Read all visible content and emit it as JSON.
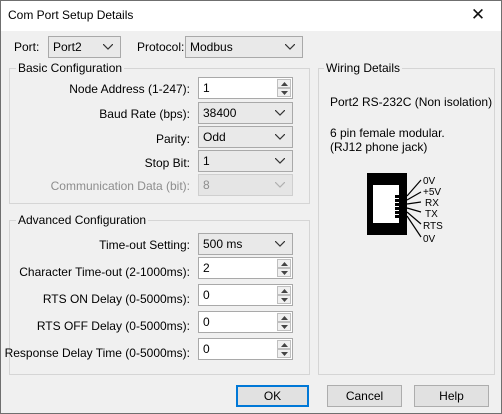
{
  "window": {
    "title": "Com Port Setup Details",
    "close_glyph": "✕"
  },
  "top": {
    "port_label": "Port:",
    "port_value": "Port2",
    "protocol_label": "Protocol:",
    "protocol_value": "Modbus"
  },
  "basic": {
    "title": "Basic Configuration",
    "node_address_label": "Node Address (1-247):",
    "node_address_value": "1",
    "baud_rate_label": "Baud Rate (bps):",
    "baud_rate_value": "38400",
    "parity_label": "Parity:",
    "parity_value": "Odd",
    "stop_bit_label": "Stop Bit:",
    "stop_bit_value": "1",
    "comm_data_label": "Communication Data (bit):",
    "comm_data_value": "8"
  },
  "advanced": {
    "title": "Advanced Configuration",
    "timeout_label": "Time-out Setting:",
    "timeout_value": "500 ms",
    "char_timeout_label": "Character Time-out (2-1000ms):",
    "char_timeout_value": "2",
    "rts_on_label": "RTS ON Delay (0-5000ms):",
    "rts_on_value": "0",
    "rts_off_label": "RTS OFF Delay (0-5000ms):",
    "rts_off_value": "0",
    "response_delay_label": "Response Delay Time (0-5000ms):",
    "response_delay_value": "0"
  },
  "wiring": {
    "title": "Wiring Details",
    "port_desc": "Port2 RS-232C (Non isolation)",
    "jack_line1": "6 pin female modular.",
    "jack_line2": "(RJ12 phone jack)",
    "pins": [
      "0V",
      "+5V",
      "RX",
      "TX",
      "RTS",
      "0V"
    ]
  },
  "buttons": {
    "ok": "OK",
    "cancel": "Cancel",
    "help": "Help"
  },
  "colors": {
    "accent": "#0078d7",
    "jack": "#000000"
  }
}
